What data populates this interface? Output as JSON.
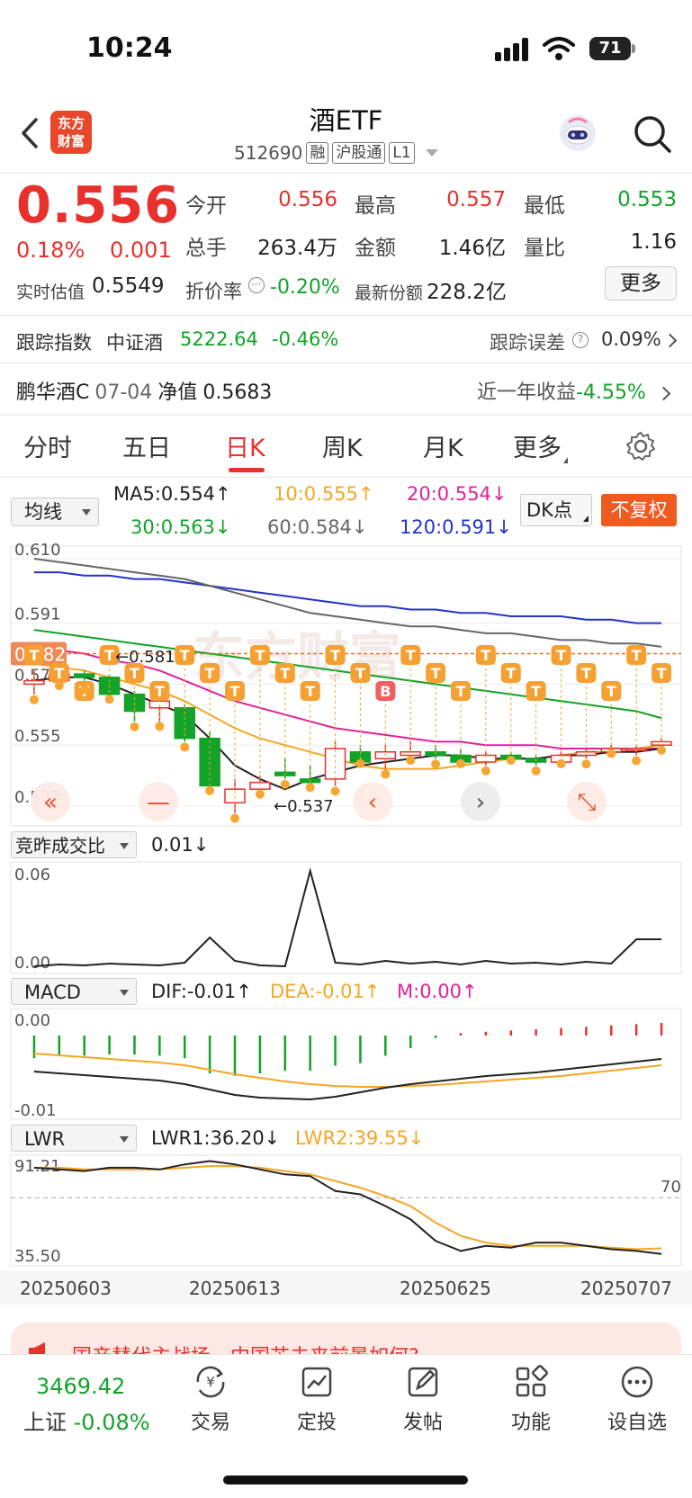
{
  "status_bar": {
    "time": "10:24",
    "battery": "71"
  },
  "header": {
    "logo_text_1": "东方",
    "logo_text_2": "财富",
    "title": "酒ETF",
    "code": "512690",
    "tags": [
      "融",
      "沪股通",
      "L1"
    ]
  },
  "quote": {
    "price": "0.556",
    "change_pct": "0.18%",
    "change_abs": "0.001",
    "stats": [
      {
        "label": "今开",
        "value": "0.556",
        "color": "#e8302d"
      },
      {
        "label": "最高",
        "value": "0.557",
        "color": "#e8302d"
      },
      {
        "label": "最低",
        "value": "0.553",
        "color": "#12a328"
      },
      {
        "label": "总手",
        "value": "263.4万",
        "color": "#222222"
      },
      {
        "label": "金额",
        "value": "1.46亿",
        "color": "#222222"
      },
      {
        "label": "量比",
        "value": "1.16",
        "color": "#222222"
      }
    ],
    "realtime_est_label": "实时估值",
    "realtime_est_value": "0.5549",
    "discount_label": "折价率",
    "discount_value": "-0.20%",
    "latest_shares_label": "最新份额",
    "latest_shares_value": "228.2亿",
    "more_label": "更多"
  },
  "tracking": {
    "index_label": "跟踪指数",
    "index_name": "中证酒",
    "index_value": "5222.64",
    "index_change": "-0.46%",
    "error_label": "跟踪误差",
    "error_value": "0.09%"
  },
  "linked_fund": {
    "name": "鹏华酒C",
    "date": "07-04",
    "nav_label": "净值",
    "nav_value": "0.5683",
    "return_label": "近一年收益",
    "return_value": "-4.55%"
  },
  "tabs": [
    {
      "label": "分时",
      "active": false
    },
    {
      "label": "五日",
      "active": false
    },
    {
      "label": "日K",
      "active": true
    },
    {
      "label": "周K",
      "active": false
    },
    {
      "label": "月K",
      "active": false
    },
    {
      "label": "更多",
      "active": false
    }
  ],
  "ma_bar": {
    "selector": "均线",
    "ma5": "MA5:0.554↑",
    "ma10": "10:0.555↑",
    "ma20": "20:0.554↓",
    "ma30": "30:0.563↓",
    "ma60": "60:0.584↓",
    "ma120": "120:0.591↓",
    "dk_label": "DK点",
    "nofq_label": "不复权",
    "colors": {
      "ma5": "#222222",
      "ma10": "#f5a623",
      "ma20": "#e0219c",
      "ma30": "#12a328",
      "ma60": "#666666",
      "ma120": "#2233cc"
    }
  },
  "kline_axis": {
    "y_labels": [
      "0.610",
      "0.591",
      "0.573",
      "0.555",
      "0.537"
    ],
    "current_price_tag": "0.582",
    "high_marker": "0.581",
    "low_marker": "0.537",
    "signal_T": "T",
    "signal_B": "B"
  },
  "volume_panel": {
    "selector": "竞昨成交比",
    "value": "0.01↓",
    "y_top": "0.06",
    "y_bottom": "0.00"
  },
  "macd_panel": {
    "selector": "MACD",
    "dif": "DIF:-0.01↑",
    "dea": "DEA:-0.01↑",
    "m": "M:0.00↑",
    "y_top": "0.00",
    "y_bottom": "-0.01"
  },
  "lwr_panel": {
    "selector": "LWR",
    "lwr1": "LWR1:36.20↓",
    "lwr2": "LWR2:39.55↓",
    "y_top": "91.21",
    "y_bottom": "35.50",
    "ref_line": "70"
  },
  "x_labels": [
    "20250603",
    "20250613",
    "20250625",
    "20250707"
  ],
  "banner": {
    "text": "国产替代主战场，中国芯未来前景如何?"
  },
  "bottom_nav": {
    "index_value": "3469.42",
    "index_name": "上证",
    "index_change": "-0.08%",
    "items": [
      {
        "label": "交易",
        "icon": "yen-cycle-icon"
      },
      {
        "label": "定投",
        "icon": "chart-doc-icon"
      },
      {
        "label": "发帖",
        "icon": "edit-icon"
      },
      {
        "label": "功能",
        "icon": "grid-icon"
      },
      {
        "label": "设自选",
        "icon": "more-circle-icon"
      }
    ]
  },
  "chart_data": {
    "type": "candlestick",
    "price_range": [
      0.537,
      0.61
    ],
    "candles": [
      {
        "o": 0.573,
        "c": 0.574,
        "h": 0.577,
        "l": 0.57
      },
      {
        "o": 0.574,
        "c": 0.576,
        "h": 0.578,
        "l": 0.572
      },
      {
        "o": 0.576,
        "c": 0.575,
        "h": 0.577,
        "l": 0.573
      },
      {
        "o": 0.575,
        "c": 0.57,
        "h": 0.576,
        "l": 0.568
      },
      {
        "o": 0.57,
        "c": 0.565,
        "h": 0.571,
        "l": 0.562
      },
      {
        "o": 0.566,
        "c": 0.568,
        "h": 0.57,
        "l": 0.56
      },
      {
        "o": 0.566,
        "c": 0.557,
        "h": 0.567,
        "l": 0.556
      },
      {
        "o": 0.557,
        "c": 0.543,
        "h": 0.559,
        "l": 0.541
      },
      {
        "o": 0.538,
        "c": 0.542,
        "h": 0.545,
        "l": 0.535
      },
      {
        "o": 0.542,
        "c": 0.544,
        "h": 0.546,
        "l": 0.54
      },
      {
        "o": 0.547,
        "c": 0.546,
        "h": 0.551,
        "l": 0.545
      },
      {
        "o": 0.545,
        "c": 0.544,
        "h": 0.549,
        "l": 0.542
      },
      {
        "o": 0.545,
        "c": 0.554,
        "h": 0.556,
        "l": 0.543
      },
      {
        "o": 0.553,
        "c": 0.55,
        "h": 0.555,
        "l": 0.549
      },
      {
        "o": 0.551,
        "c": 0.553,
        "h": 0.555,
        "l": 0.548
      },
      {
        "o": 0.552,
        "c": 0.553,
        "h": 0.556,
        "l": 0.55
      },
      {
        "o": 0.553,
        "c": 0.552,
        "h": 0.555,
        "l": 0.551
      },
      {
        "o": 0.552,
        "c": 0.55,
        "h": 0.554,
        "l": 0.549
      },
      {
        "o": 0.55,
        "c": 0.552,
        "h": 0.553,
        "l": 0.549
      },
      {
        "o": 0.552,
        "c": 0.551,
        "h": 0.553,
        "l": 0.55
      },
      {
        "o": 0.551,
        "c": 0.55,
        "h": 0.552,
        "l": 0.549
      },
      {
        "o": 0.55,
        "c": 0.552,
        "h": 0.553,
        "l": 0.549
      },
      {
        "o": 0.552,
        "c": 0.553,
        "h": 0.554,
        "l": 0.551
      },
      {
        "o": 0.553,
        "c": 0.554,
        "h": 0.555,
        "l": 0.552
      },
      {
        "o": 0.554,
        "c": 0.554,
        "h": 0.555,
        "l": 0.552
      },
      {
        "o": 0.555,
        "c": 0.556,
        "h": 0.557,
        "l": 0.553
      }
    ],
    "signals": [
      "T",
      "T",
      "T",
      "T",
      "T",
      "T",
      "T",
      "T",
      "T",
      "T",
      "T",
      "T",
      "T",
      "T",
      "B",
      "T",
      "T",
      "T",
      "T",
      "T",
      "T",
      "T",
      "T",
      "T",
      "T",
      "T"
    ],
    "ma_lines": {
      "ma5": [
        0.574,
        0.575,
        0.575,
        0.573,
        0.57,
        0.567,
        0.564,
        0.557,
        0.549,
        0.545,
        0.542,
        0.545,
        0.547,
        0.549,
        0.55,
        0.551,
        0.552,
        0.552,
        0.551,
        0.551,
        0.551,
        0.552,
        0.552,
        0.553,
        0.553,
        0.554
      ],
      "ma10": [
        0.579,
        0.578,
        0.577,
        0.575,
        0.573,
        0.571,
        0.568,
        0.564,
        0.56,
        0.557,
        0.555,
        0.553,
        0.551,
        0.549,
        0.548,
        0.548,
        0.548,
        0.549,
        0.55,
        0.551,
        0.551,
        0.552,
        0.553,
        0.553,
        0.554,
        0.555
      ],
      "ma20": [
        0.584,
        0.583,
        0.582,
        0.58,
        0.579,
        0.577,
        0.574,
        0.571,
        0.568,
        0.566,
        0.564,
        0.562,
        0.56,
        0.559,
        0.558,
        0.557,
        0.556,
        0.556,
        0.555,
        0.555,
        0.555,
        0.554,
        0.554,
        0.554,
        0.554,
        0.554
      ],
      "ma30": [
        0.589,
        0.588,
        0.587,
        0.586,
        0.585,
        0.584,
        0.583,
        0.582,
        0.581,
        0.58,
        0.579,
        0.578,
        0.577,
        0.576,
        0.575,
        0.574,
        0.573,
        0.572,
        0.571,
        0.57,
        0.569,
        0.568,
        0.567,
        0.566,
        0.565,
        0.563
      ],
      "ma60": [
        0.61,
        0.609,
        0.608,
        0.607,
        0.606,
        0.605,
        0.604,
        0.602,
        0.6,
        0.598,
        0.596,
        0.594,
        0.593,
        0.592,
        0.591,
        0.59,
        0.59,
        0.589,
        0.588,
        0.588,
        0.587,
        0.586,
        0.586,
        0.585,
        0.585,
        0.584
      ],
      "ma120": [
        0.606,
        0.606,
        0.605,
        0.605,
        0.604,
        0.604,
        0.603,
        0.602,
        0.601,
        0.6,
        0.599,
        0.598,
        0.597,
        0.596,
        0.596,
        0.595,
        0.595,
        0.594,
        0.594,
        0.593,
        0.593,
        0.593,
        0.592,
        0.592,
        0.591,
        0.591
      ]
    },
    "volume_ratio": [
      0.0,
      0.0,
      0.0,
      0.0,
      0.0,
      0.0,
      0.0,
      0.01,
      0.0,
      0.0,
      0.0,
      0.06,
      0.0,
      0.0,
      0.0,
      0.0,
      0.0,
      0.0,
      0.0,
      0.0,
      0.0,
      0.0,
      0.0,
      0.0,
      0.01,
      0.01
    ],
    "macd": {
      "hist": [
        -0.0018,
        -0.0016,
        -0.0016,
        -0.0015,
        -0.0015,
        -0.0016,
        -0.0018,
        -0.003,
        -0.0032,
        -0.003,
        -0.0028,
        -0.0028,
        -0.0024,
        -0.0022,
        -0.0016,
        -0.001,
        -0.0002,
        0.0002,
        0.0003,
        0.0004,
        0.0005,
        0.0006,
        0.0007,
        0.0008,
        0.0009,
        0.001
      ],
      "dif": [
        -0.006,
        -0.0062,
        -0.0064,
        -0.0066,
        -0.0068,
        -0.007,
        -0.0074,
        -0.008,
        -0.0086,
        -0.0089,
        -0.009,
        -0.0091,
        -0.0088,
        -0.0083,
        -0.0078,
        -0.0074,
        -0.0071,
        -0.0068,
        -0.0065,
        -0.0063,
        -0.0061,
        -0.0058,
        -0.0055,
        -0.0052,
        -0.0049,
        -0.0046
      ],
      "dea": [
        -0.004,
        -0.0042,
        -0.0044,
        -0.0046,
        -0.0048,
        -0.005,
        -0.0053,
        -0.0058,
        -0.0063,
        -0.0067,
        -0.0071,
        -0.0074,
        -0.0076,
        -0.0077,
        -0.0077,
        -0.0076,
        -0.0075,
        -0.0073,
        -0.0071,
        -0.0069,
        -0.0067,
        -0.0065,
        -0.0062,
        -0.0059,
        -0.0056,
        -0.0053
      ]
    },
    "lwr": {
      "lwr1": [
        88,
        87,
        86,
        88,
        88,
        87,
        90,
        92,
        90,
        87,
        84,
        83,
        74,
        72,
        65,
        57,
        44,
        38,
        41,
        40,
        43,
        43,
        41,
        39,
        38,
        36.2
      ],
      "lwr2": [
        88,
        88,
        87,
        87,
        87,
        87,
        88,
        89,
        89,
        88,
        86,
        84,
        80,
        76,
        71,
        65,
        55,
        47,
        43,
        41,
        41,
        41,
        41,
        40,
        39,
        39.55
      ],
      "ref": 70,
      "range": [
        35.5,
        91.21
      ]
    },
    "x_ticks": [
      "20250603",
      "20250613",
      "20250625",
      "20250707"
    ]
  }
}
